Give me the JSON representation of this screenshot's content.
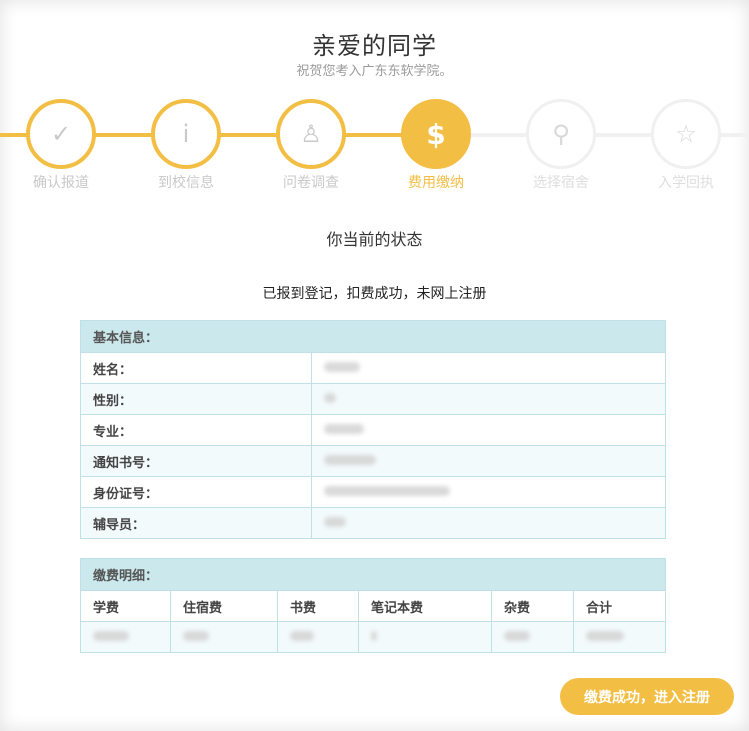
{
  "header": {
    "title": "亲爱的同学",
    "subtitle": "祝贺您考入广东东软学院。"
  },
  "colors": {
    "accent": "#f3be44",
    "table_header": "#cbe8ec",
    "table_border": "#bfe0e4"
  },
  "steps": [
    {
      "label": "确认报道",
      "icon": "check-icon",
      "glyph": "✓",
      "state": "done"
    },
    {
      "label": "到校信息",
      "icon": "info-icon",
      "glyph": "i",
      "state": "done"
    },
    {
      "label": "问卷调查",
      "icon": "user-icon",
      "glyph": "♙",
      "state": "done"
    },
    {
      "label": "费用缴纳",
      "icon": "dollar-icon",
      "glyph": "$",
      "state": "active"
    },
    {
      "label": "选择宿舍",
      "icon": "pin-icon",
      "glyph": "⚲",
      "state": "todo"
    },
    {
      "label": "入学回执",
      "icon": "star-icon",
      "glyph": "☆",
      "state": "todo"
    }
  ],
  "status": {
    "heading": "你当前的状态",
    "text": "已报到登记，扣费成功，未网上注册"
  },
  "basic_info": {
    "header": "基本信息：",
    "rows": [
      {
        "label": "姓名："
      },
      {
        "label": "性别："
      },
      {
        "label": "专业："
      },
      {
        "label": "通知书号："
      },
      {
        "label": "身份证号："
      },
      {
        "label": "辅导员："
      }
    ]
  },
  "fee_details": {
    "header": "缴费明细：",
    "columns": [
      "学费",
      "住宿费",
      "书费",
      "笔记本费",
      "杂费",
      "合计"
    ]
  },
  "actions": {
    "submit_label": "缴费成功，进入注册"
  }
}
